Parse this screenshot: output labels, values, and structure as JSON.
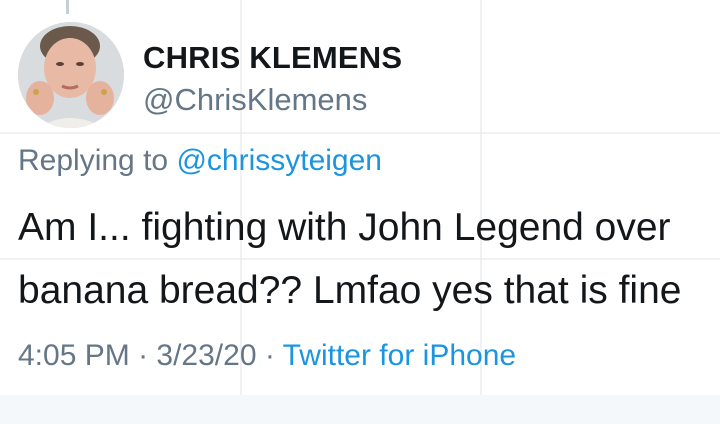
{
  "tweet": {
    "author": {
      "display_name": "CHRIS KLEMENS",
      "handle": "@ChrisKlemens",
      "avatar": "profile-photo"
    },
    "reply": {
      "prefix": "Replying to",
      "mention": "@chrissyteigen"
    },
    "text": {
      "line1": "Am I... fighting with John Legend over",
      "line2": "banana bread?? Lmfao yes that is fine"
    },
    "meta": {
      "time": "4:05 PM",
      "separator1": " · ",
      "date": "3/23/20",
      "separator2": " · ",
      "source": "Twitter for iPhone"
    }
  },
  "colors": {
    "text_primary": "#14171a",
    "text_secondary": "#657786",
    "link": "#1b95e0",
    "background": "#ffffff",
    "footer_background": "#f5f8fa"
  }
}
